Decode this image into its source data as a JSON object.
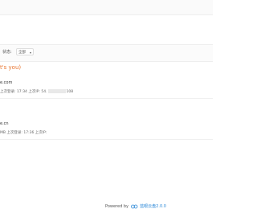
{
  "filter": {
    "label": "状态:",
    "status_value": "全部"
  },
  "me_label": "t's you)",
  "users": [
    {
      "email": "e.com",
      "meta_prefix": "上次登录: 17:34",
      "meta_ip_label": "上次IP: 54.",
      "meta_ip_suffix": "108"
    },
    {
      "email": "e.cn",
      "meta_prefix": "MB 上次登录: 17:36",
      "meta_ip_label": "上次IP:",
      "meta_ip_suffix": ""
    }
  ],
  "footer": {
    "powered_by": "Powered by",
    "brand": "蓝眼云盘2.0.0"
  },
  "colors": {
    "accent_orange": "#e8742f",
    "brand_blue": "#2f8ad8"
  }
}
